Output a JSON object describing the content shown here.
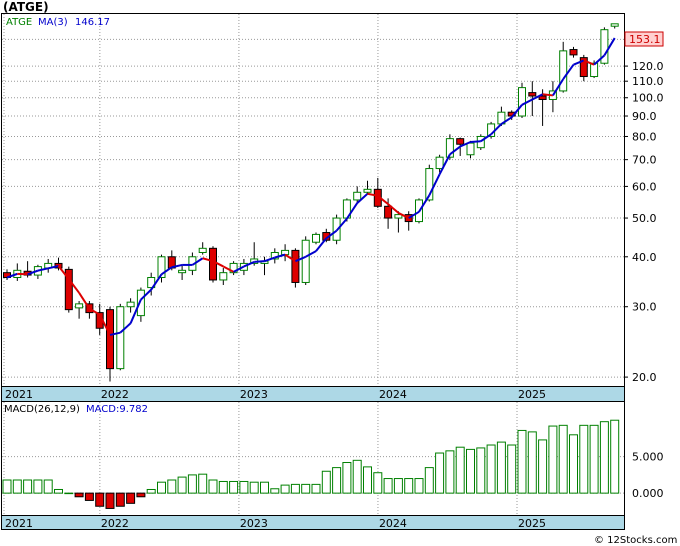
{
  "title": "(ATGE)",
  "price_legend": {
    "ticker": "ATGE",
    "ma_label": "MA(3)",
    "ma_value": "146.17"
  },
  "last_price_label": "153.1",
  "macd_legend": {
    "params": "MACD(26,12,9)",
    "value": "MACD:9.782"
  },
  "footer": "© 12Stocks.com",
  "colors": {
    "up": "#008000",
    "down": "#dd0000",
    "ma_up": "#0000cc",
    "ma_down": "#dd0000",
    "axis_band": "#add8e6",
    "macd_bar": "#008000"
  },
  "chart_data": [
    {
      "type": "candlestick",
      "name": "price",
      "yscale": "log",
      "ylim": [
        19,
        162
      ],
      "yticks": [
        "20.0",
        "30.0",
        "40.0",
        "50.0",
        "60.0",
        "70.0",
        "80.0",
        "90.0",
        "100.0",
        "110.0",
        "120.0",
        "140.0"
      ],
      "xticks": [
        "2021",
        "2022",
        "2023",
        "2024",
        "2025"
      ],
      "grid": true,
      "ohlc": [
        [
          36.5,
          37.2,
          35.0,
          35.5
        ],
        [
          35.5,
          38.5,
          34.8,
          37.0
        ],
        [
          36.8,
          39.0,
          35.5,
          36.0
        ],
        [
          36.0,
          38.2,
          35.2,
          37.8
        ],
        [
          37.5,
          39.5,
          36.5,
          38.5
        ],
        [
          38.5,
          39.8,
          37.0,
          37.5
        ],
        [
          37.2,
          37.8,
          29.0,
          29.5
        ],
        [
          29.8,
          31.0,
          28.0,
          30.5
        ],
        [
          30.5,
          31.0,
          28.0,
          29.0
        ],
        [
          29.0,
          30.5,
          25.5,
          26.5
        ],
        [
          29.5,
          30.0,
          19.5,
          21.0
        ],
        [
          21.0,
          30.5,
          20.8,
          30.0
        ],
        [
          30.0,
          31.5,
          29.0,
          30.8
        ],
        [
          28.5,
          33.5,
          27.5,
          33.0
        ],
        [
          33.5,
          36.5,
          32.0,
          35.5
        ],
        [
          35.5,
          40.5,
          34.5,
          40.0
        ],
        [
          40.0,
          41.5,
          37.0,
          37.5
        ],
        [
          36.5,
          38.0,
          35.0,
          37.0
        ],
        [
          37.0,
          41.0,
          36.0,
          40.0
        ],
        [
          41.0,
          43.5,
          40.5,
          42.0
        ],
        [
          42.0,
          42.5,
          34.5,
          35.0
        ],
        [
          35.0,
          37.5,
          34.0,
          36.5
        ],
        [
          36.5,
          39.0,
          36.0,
          38.5
        ],
        [
          37.0,
          39.5,
          36.0,
          38.5
        ],
        [
          38.5,
          43.5,
          38.0,
          39.5
        ],
        [
          38.5,
          40.0,
          36.0,
          39.0
        ],
        [
          39.5,
          42.0,
          38.5,
          41.0
        ],
        [
          40.5,
          43.0,
          39.0,
          41.5
        ],
        [
          41.5,
          42.0,
          33.5,
          34.5
        ],
        [
          34.5,
          45.0,
          34.0,
          44.0
        ],
        [
          43.5,
          46.0,
          43.0,
          45.5
        ],
        [
          46.0,
          47.0,
          43.5,
          44.0
        ],
        [
          44.0,
          51.0,
          43.0,
          50.0
        ],
        [
          50.0,
          56.0,
          49.0,
          55.5
        ],
        [
          55.5,
          60.0,
          54.5,
          58.0
        ],
        [
          58.0,
          62.0,
          57.5,
          59.0
        ],
        [
          59.0,
          63.0,
          53.0,
          53.5
        ],
        [
          53.5,
          56.0,
          47.0,
          50.0
        ],
        [
          50.0,
          52.0,
          46.0,
          51.0
        ],
        [
          51.0,
          52.0,
          46.5,
          49.0
        ],
        [
          49.0,
          56.0,
          48.5,
          55.5
        ],
        [
          55.5,
          68.0,
          55.0,
          66.5
        ],
        [
          66.5,
          72.0,
          65.0,
          71.0
        ],
        [
          71.0,
          81.0,
          70.0,
          79.0
        ],
        [
          79.0,
          79.5,
          71.5,
          76.5
        ],
        [
          72.0,
          78.0,
          70.5,
          77.0
        ],
        [
          75.0,
          81.0,
          74.0,
          80.0
        ],
        [
          80.0,
          87.0,
          79.0,
          86.0
        ],
        [
          86.0,
          95.0,
          85.0,
          92.0
        ],
        [
          92.0,
          93.0,
          88.0,
          90.0
        ],
        [
          90.0,
          109.0,
          89.0,
          106.0
        ],
        [
          103.0,
          110.0,
          90.0,
          101.0
        ],
        [
          101.0,
          105.0,
          85.0,
          99.0
        ],
        [
          99.0,
          110.0,
          92.0,
          104.0
        ],
        [
          104.0,
          138.0,
          103.0,
          131.0
        ],
        [
          132.0,
          134.0,
          126.0,
          128.0
        ],
        [
          126.0,
          128.0,
          110.0,
          113.0
        ],
        [
          113.0,
          124.0,
          112.0,
          122.0
        ],
        [
          122.0,
          150.0,
          121.0,
          148.0
        ],
        [
          151.0,
          153.0,
          149.0,
          153.1
        ]
      ]
    },
    {
      "type": "bar",
      "name": "macd",
      "ylim": [
        -3.0,
        12.5
      ],
      "yticks": [
        "0.000",
        "5.000"
      ],
      "xticks": [
        "2021",
        "2022",
        "2023",
        "2024",
        "2025"
      ],
      "values": [
        1.8,
        1.8,
        1.8,
        1.8,
        1.8,
        0.5,
        0,
        -0.5,
        -1.0,
        -1.8,
        -2.1,
        -1.8,
        -1.4,
        -0.5,
        0.5,
        1.5,
        1.8,
        2.2,
        2.5,
        2.6,
        1.8,
        1.6,
        1.6,
        1.6,
        1.5,
        1.5,
        0.6,
        1.1,
        1.2,
        1.2,
        1.2,
        3.0,
        3.5,
        4.2,
        4.5,
        3.6,
        2.8,
        2.0,
        2.0,
        2.0,
        2.0,
        3.5,
        5.5,
        5.8,
        6.3,
        6.0,
        6.2,
        6.6,
        7.0,
        6.6,
        8.6,
        8.4,
        7.3,
        9.2,
        9.3,
        8.0,
        9.3,
        9.3,
        9.8,
        10.0
      ]
    }
  ]
}
